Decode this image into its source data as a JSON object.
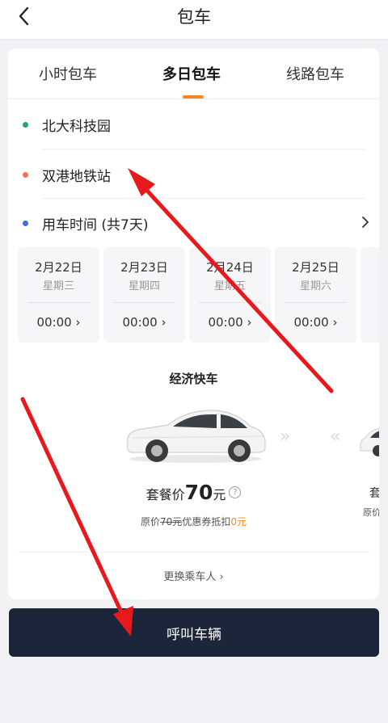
{
  "header": {
    "title": "包车",
    "back_icon": "chevron-left-icon"
  },
  "tabs": [
    {
      "label": "小时包车",
      "active": false
    },
    {
      "label": "多日包车",
      "active": true
    },
    {
      "label": "线路包车",
      "active": false
    }
  ],
  "route": {
    "start": "北大科技园",
    "end": "双港地铁站",
    "time_label": "用车时间 (共7天)"
  },
  "days": [
    {
      "date": "2月22日",
      "weekday": "星期三",
      "time": "00:00"
    },
    {
      "date": "2月23日",
      "weekday": "星期四",
      "time": "00:00"
    },
    {
      "date": "2月24日",
      "weekday": "星期五",
      "time": "00:00"
    },
    {
      "date": "2月25日",
      "weekday": "星期六",
      "time": "00:00"
    }
  ],
  "car": {
    "type": "经济快车",
    "price_label": "套餐价",
    "price_value": "70",
    "price_unit": "元",
    "orig_prefix": "原价",
    "orig_price": "70元",
    "discount_text": "优惠券抵扣",
    "discount_value": "0元",
    "side_partial_label": "套",
    "side_partial_orig": "原价"
  },
  "change_passenger": "更换乘车人",
  "call_button": "呼叫车辆",
  "colors": {
    "accent": "#f28a1e",
    "start_dot": "#2e9e6b",
    "end_dot": "#f0705a",
    "time_dot": "#3f6fd8",
    "button_bg": "#1c2539",
    "annotation_arrow": "#e8191c"
  }
}
